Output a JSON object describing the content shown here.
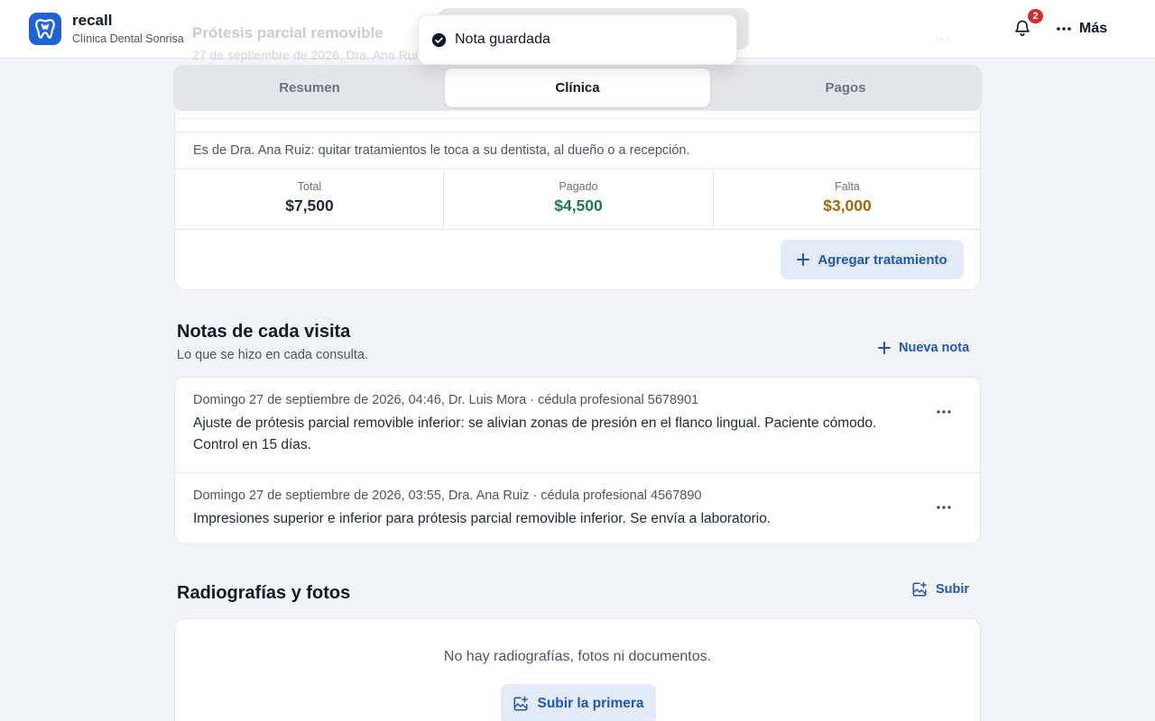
{
  "brand": {
    "name": "recall",
    "subtitle": "Clínica Dental Sonrisa"
  },
  "background_context": {
    "title": "Prótesis parcial removible",
    "subtitle": "27 de septiembre de 2026, Dra. Ana Ruiz"
  },
  "header": {
    "notification_count": "2",
    "more_label": "Más"
  },
  "toast": {
    "message": "Nota guardada"
  },
  "tabs": [
    {
      "label": "Resumen",
      "active": false
    },
    {
      "label": "Clínica",
      "active": true
    },
    {
      "label": "Pagos",
      "active": false
    }
  ],
  "treatment": {
    "owner_note": "Es de Dra. Ana Ruiz: quitar tratamientos le toca a su dentista, al dueño o a recepción.",
    "totals": [
      {
        "label": "Total",
        "value": "$7,500",
        "color": "#1f2937"
      },
      {
        "label": "Pagado",
        "value": "$4,500",
        "color": "#1d7a4e"
      },
      {
        "label": "Falta",
        "value": "$3,000",
        "color": "#a1670a"
      }
    ],
    "add_label": "Agregar tratamiento"
  },
  "notes_section": {
    "title": "Notas de cada visita",
    "subtitle": "Lo que se hizo en cada consulta.",
    "new_label": "Nueva nota",
    "items": [
      {
        "meta": "Domingo 27 de septiembre de 2026, 04:46, Dr. Luis Mora · cédula profesional 5678901",
        "text": "Ajuste de prótesis parcial removible inferior: se alivian zonas de presión en el flanco lingual. Paciente cómodo. Control en 15 días."
      },
      {
        "meta": "Domingo 27 de septiembre de 2026, 03:55, Dra. Ana Ruiz · cédula profesional 4567890",
        "text": "Impresiones superior e inferior para prótesis parcial removible inferior. Se envía a laboratorio."
      }
    ]
  },
  "media_section": {
    "title": "Radiografías y fotos",
    "upload_label": "Subir",
    "empty_message": "No hay radiografías, fotos ni documentos.",
    "upload_first_label": "Subir la primera"
  },
  "colors": {
    "accent": "#1f56b8",
    "brand": "#1f63d6",
    "badge": "#d12f2f"
  }
}
